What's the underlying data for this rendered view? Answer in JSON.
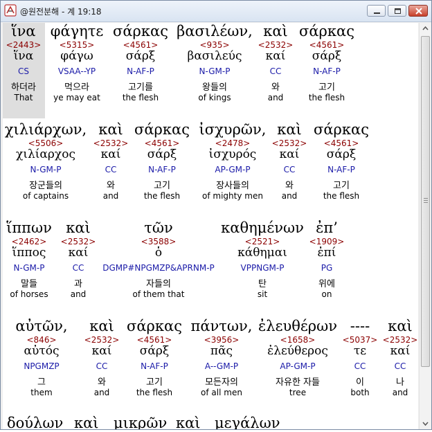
{
  "window": {
    "title": "@원전분해 - 계 19:18",
    "controls": {
      "minimize": "minimize",
      "maximize": "maximize",
      "close": "close"
    }
  },
  "colors": {
    "strongs": "#8b0000",
    "parse": "#1a1aa8",
    "highlight": "#dedede"
  },
  "rows": [
    {
      "words": [
        {
          "g": "ἵνα",
          "sn": "<2443>",
          "lx": "ἵνα",
          "pc": "CS",
          "ko": "하더라",
          "en": "That"
        },
        {
          "g": "φάγητε",
          "sn": "<5315>",
          "lx": "φάγω",
          "pc": "VSAA--YP",
          "ko": "먹으라",
          "en": "ye may eat"
        },
        {
          "g": "σάρκας",
          "sn": "<4561>",
          "lx": "σάρξ",
          "pc": "N-AF-P",
          "ko": "고기를",
          "en": "the flesh"
        },
        {
          "g": "βασιλέων,",
          "sn": "<935>",
          "lx": "βασιλεύς",
          "pc": "N-GM-P",
          "ko": "왕들의",
          "en": "of kings"
        },
        {
          "g": "καὶ",
          "sn": "<2532>",
          "lx": "καί",
          "pc": "CC",
          "ko": "와",
          "en": "and"
        },
        {
          "g": "σάρκας",
          "sn": "<4561>",
          "lx": "σάρξ",
          "pc": "N-AF-P",
          "ko": "고기",
          "en": "the flesh"
        }
      ]
    },
    {
      "words": [
        {
          "g": "χιλιάρχων,",
          "sn": "<5506>",
          "lx": "χιλίαρχος",
          "pc": "N-GM-P",
          "ko": "장군들의",
          "en": "of captains"
        },
        {
          "g": "καὶ",
          "sn": "<2532>",
          "lx": "καί",
          "pc": "CC",
          "ko": "와",
          "en": "and"
        },
        {
          "g": "σάρκας",
          "sn": "<4561>",
          "lx": "σάρξ",
          "pc": "N-AF-P",
          "ko": "고기",
          "en": "the flesh"
        },
        {
          "g": "ἰσχυρῶν,",
          "sn": "<2478>",
          "lx": "ἰσχυρός",
          "pc": "AP-GM-P",
          "ko": "장사들의",
          "en": "of mighty men"
        },
        {
          "g": "καὶ",
          "sn": "<2532>",
          "lx": "καί",
          "pc": "CC",
          "ko": "와",
          "en": "and"
        },
        {
          "g": "σάρκας",
          "sn": "<4561>",
          "lx": "σάρξ",
          "pc": "N-AF-P",
          "ko": "고기",
          "en": "the flesh"
        }
      ]
    },
    {
      "words": [
        {
          "g": "ἵππων",
          "sn": "<2462>",
          "lx": "ἵππος",
          "pc": "N-GM-P",
          "ko": "말들",
          "en": "of horses"
        },
        {
          "g": "καὶ",
          "sn": "<2532>",
          "lx": "καί",
          "pc": "CC",
          "ko": "과",
          "en": "and"
        },
        {
          "g": "τῶν",
          "sn": "<3588>",
          "lx": "ὁ",
          "pc": "DGMP#NPGMZP&APRNM-P",
          "ko": "자들의",
          "en": "of them that"
        },
        {
          "g": "καθημένων",
          "sn": "<2521>",
          "lx": "κάθημαι",
          "pc": "VPPNGM-P",
          "ko": "탄",
          "en": "sit"
        },
        {
          "g": "ἐπ’",
          "sn": "<1909>",
          "lx": "ἐπί",
          "pc": "PG",
          "ko": "위에",
          "en": "on"
        }
      ]
    },
    {
      "words": [
        {
          "g": "αὐτῶν,",
          "sn": "<846>",
          "lx": "αὐτός",
          "pc": "NPGMZP",
          "ko": "그",
          "en": "them"
        },
        {
          "g": "καὶ",
          "sn": "<2532>",
          "lx": "καί",
          "pc": "CC",
          "ko": "와",
          "en": "and"
        },
        {
          "g": "σάρκας",
          "sn": "<4561>",
          "lx": "σάρξ",
          "pc": "N-AF-P",
          "ko": "고기",
          "en": "the flesh"
        },
        {
          "g": "πάντων,",
          "sn": "<3956>",
          "lx": "πᾶς",
          "pc": "A--GM-P",
          "ko": "모든자의",
          "en": "of all men"
        },
        {
          "g": "ἐλευθέρων",
          "sn": "<1658>",
          "lx": "ἐλεύθερος",
          "pc": "AP-GM-P",
          "ko": "자유한 자들",
          "en": "tree"
        },
        {
          "g": "----",
          "sn": "<5037>",
          "lx": "τε",
          "pc": "CC",
          "ko": "이",
          "en": "both"
        },
        {
          "g": "καὶ",
          "sn": "<2532>",
          "lx": "καί",
          "pc": "CC",
          "ko": "나",
          "en": "and"
        }
      ]
    }
  ],
  "partial_row": [
    "δούλων",
    "καὶ",
    "μικρῶν",
    "καὶ",
    "μεγάλων"
  ]
}
